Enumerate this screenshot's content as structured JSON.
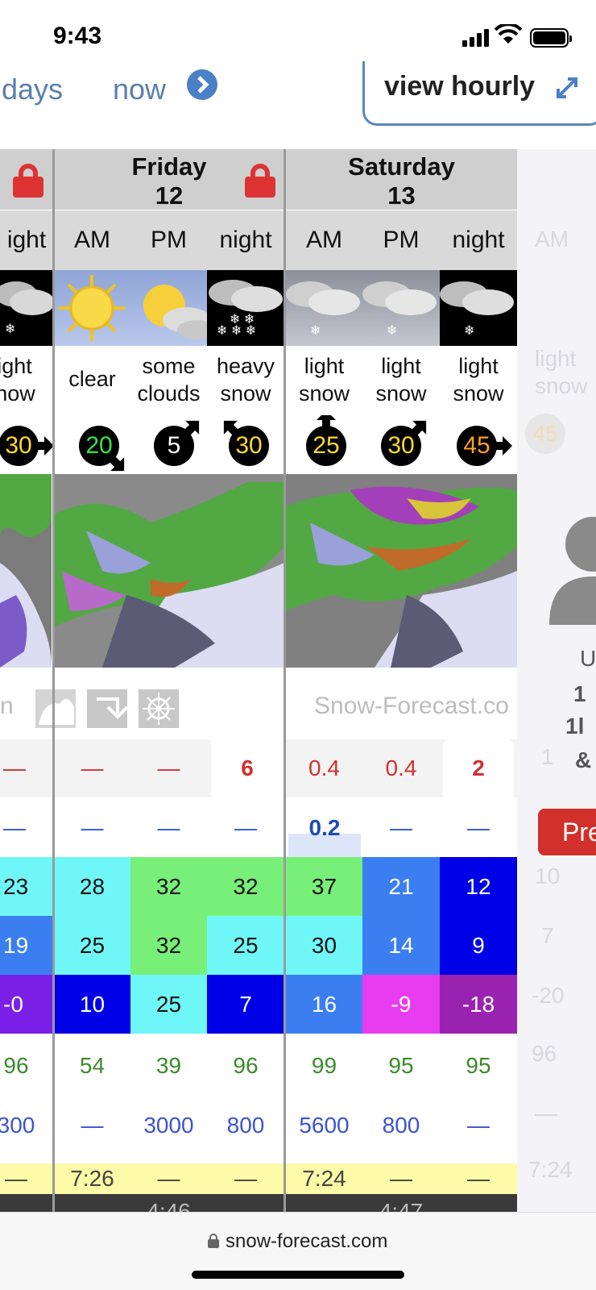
{
  "status": {
    "time": "9:43"
  },
  "nav": {
    "days_label": "days",
    "now_label": "now",
    "hourly_label": "view hourly"
  },
  "days": [
    {
      "name": "Friday",
      "date": "12"
    },
    {
      "name": "Saturday",
      "date": "13"
    }
  ],
  "periods": [
    "ight",
    "AM",
    "PM",
    "night",
    "AM",
    "PM",
    "night",
    "AM"
  ],
  "weather": [
    {
      "text": [
        "ight",
        "now"
      ],
      "icon": "snow-cloud-night-icon"
    },
    {
      "text": [
        "clear"
      ],
      "icon": "sun-icon"
    },
    {
      "text": [
        "some",
        "clouds"
      ],
      "icon": "sun-cloud-icon"
    },
    {
      "text": [
        "heavy",
        "snow"
      ],
      "icon": "heavy-snow-night-icon"
    },
    {
      "text": [
        "light",
        "snow"
      ],
      "icon": "snow-cloud-icon"
    },
    {
      "text": [
        "light",
        "snow"
      ],
      "icon": "snow-cloud-icon"
    },
    {
      "text": [
        "light",
        "snow"
      ],
      "icon": "snow-cloud-night-icon"
    },
    {
      "text": [
        "light",
        "snow"
      ],
      "icon": "snow-cloud-icon"
    }
  ],
  "wind": [
    {
      "speed": "30",
      "color": "#ffd92a",
      "direction": "E"
    },
    {
      "speed": "20",
      "color": "#33e64a",
      "direction": "SE"
    },
    {
      "speed": "5",
      "color": "#ffffff",
      "direction": "NE"
    },
    {
      "speed": "30",
      "color": "#ffd92a",
      "direction": "NW"
    },
    {
      "speed": "25",
      "color": "#ffd92a",
      "direction": "N"
    },
    {
      "speed": "30",
      "color": "#ffd92a",
      "direction": "NE"
    },
    {
      "speed": "45",
      "color": "#ff9e2a",
      "direction": "E"
    },
    {
      "speed": "45",
      "color": "#ff9e2a",
      "direction": "E"
    }
  ],
  "legend": {
    "brand": "Snow-Forecast.co",
    "left_text": "n"
  },
  "snow": [
    "—",
    "—",
    "—",
    "6",
    "0.4",
    "0.4",
    "2",
    "1"
  ],
  "rain": [
    "—",
    "—",
    "—",
    "—",
    "0.2",
    "—",
    "—",
    ""
  ],
  "temp_max": [
    {
      "v": "23",
      "bg": "#6ff7f7"
    },
    {
      "v": "28",
      "bg": "#6ff7f7"
    },
    {
      "v": "32",
      "bg": "#78ef78"
    },
    {
      "v": "32",
      "bg": "#78ef78"
    },
    {
      "v": "37",
      "bg": "#78ef78"
    },
    {
      "v": "21",
      "bg": "#3b7ef2"
    },
    {
      "v": "12",
      "bg": "#0000e6"
    },
    {
      "v": "10",
      "bg": "#f1f1f4"
    }
  ],
  "temp_min": [
    {
      "v": "19",
      "bg": "#3b7ef2"
    },
    {
      "v": "25",
      "bg": "#6ff7f7"
    },
    {
      "v": "32",
      "bg": "#78ef78"
    },
    {
      "v": "25",
      "bg": "#6ff7f7"
    },
    {
      "v": "30",
      "bg": "#6ff7f7"
    },
    {
      "v": "14",
      "bg": "#3b7ef2"
    },
    {
      "v": "9",
      "bg": "#0000e6"
    },
    {
      "v": "7",
      "bg": "#f1f1f4"
    }
  ],
  "temp_chill": [
    {
      "v": "-0",
      "bg": "#7a1fe6"
    },
    {
      "v": "10",
      "bg": "#0000e6"
    },
    {
      "v": "25",
      "bg": "#6ff7f7"
    },
    {
      "v": "7",
      "bg": "#0000e6"
    },
    {
      "v": "16",
      "bg": "#3b7ef2"
    },
    {
      "v": "-9",
      "bg": "#e83cf0"
    },
    {
      "v": "-18",
      "bg": "#9a22b0"
    },
    {
      "v": "-20",
      "bg": "#f1f1f4"
    }
  ],
  "humidity": [
    "96",
    "54",
    "39",
    "96",
    "99",
    "95",
    "95",
    "96"
  ],
  "freezing": [
    "300",
    "—",
    "3000",
    "800",
    "5600",
    "800",
    "—",
    "—"
  ],
  "sunrise": [
    "—",
    "7:26",
    "—",
    "—",
    "7:24",
    "—",
    "—",
    "7:24"
  ],
  "sunset": [
    "4:46",
    "4:47"
  ],
  "right_panel": {
    "lines": [
      "U",
      "1",
      "1l",
      "&"
    ],
    "pre_label": "Pre"
  },
  "browser": {
    "url": "snow-forecast.com"
  }
}
